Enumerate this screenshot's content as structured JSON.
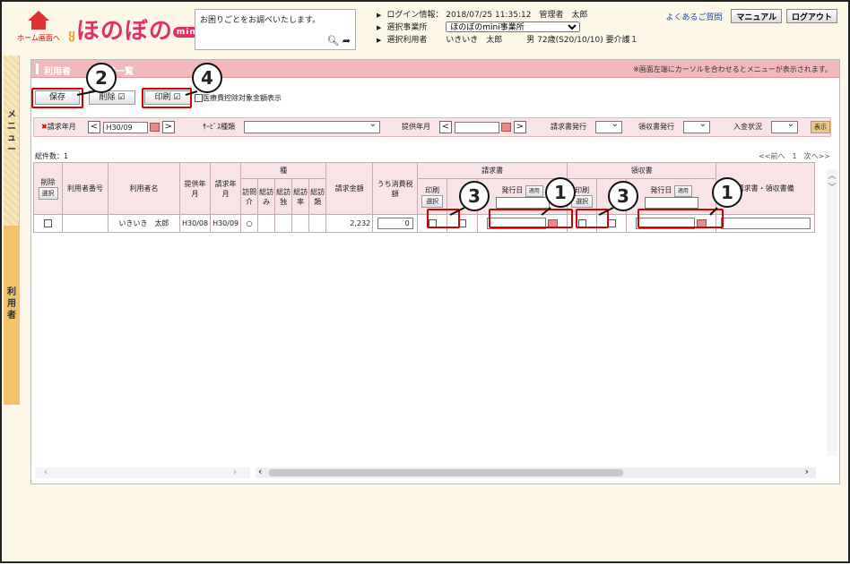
{
  "header": {
    "home_label": "ホーム画面へ",
    "logo_text": "ほのぼの",
    "logo_mini": "mini",
    "help_text": "お困りごとをお調べいたします。",
    "login_label": "ログイン情報：",
    "login_value": "2018/07/25 11:35:12　管理者　太郎",
    "office_label": "選択事業所",
    "office_value": "ほのぼのmini事業所",
    "user_label": "選択利用者",
    "user_value": "いきいき　太郎　　　男 72歳(S20/10/10) 要介護１",
    "faq": "よくあるご質問",
    "manual": "マニュアル",
    "logout": "ログアウト"
  },
  "side": {
    "menu_label": "メニュー",
    "user_label": "利用者"
  },
  "panel": {
    "title": "利用者　　　請求一覧",
    "note": "※画面左端にカーソルを合わせるとメニューが表示されます。",
    "save": "保存",
    "delete": "削除",
    "print": "印刷",
    "medical_check": "医療費控除対象金額表示"
  },
  "filters": {
    "billing_month_label": "請求年月",
    "billing_month_value": "H30/09",
    "service_type_label": "ｻｰﾋﾞｽ種類",
    "provide_month_label": "提供年月",
    "invoice_issue_label": "請求書発行",
    "receipt_issue_label": "領収書発行",
    "payment_label": "入金状況",
    "show_button": "表示"
  },
  "list": {
    "count_label": "総件数：1",
    "pager": "<<前へ　1　次へ>>",
    "headers": {
      "del": "削除",
      "select": "選択",
      "user_no": "利用者番号",
      "user_name": "利用者名",
      "provide": "提供年月",
      "billing": "請求年月",
      "type": "種",
      "types": [
        "訪問介",
        "総訪み",
        "総訪独",
        "総訪率",
        "総訪類"
      ],
      "amount": "請求金額",
      "tax": "うち消費税額",
      "invoice": "請求書",
      "receipt": "領収書",
      "print": "印刷",
      "issue_date": "発行日",
      "apply": "適用",
      "remarks": "請求書・領収書備"
    },
    "rows": [
      {
        "name": "いきいき　太郎",
        "provide": "H30/08",
        "billing": "H30/09",
        "mark": "○",
        "amount": "2,232",
        "tax": "0"
      }
    ]
  },
  "callouts": {
    "c1": "1",
    "c2": "2",
    "c3": "3",
    "c4": "4"
  }
}
